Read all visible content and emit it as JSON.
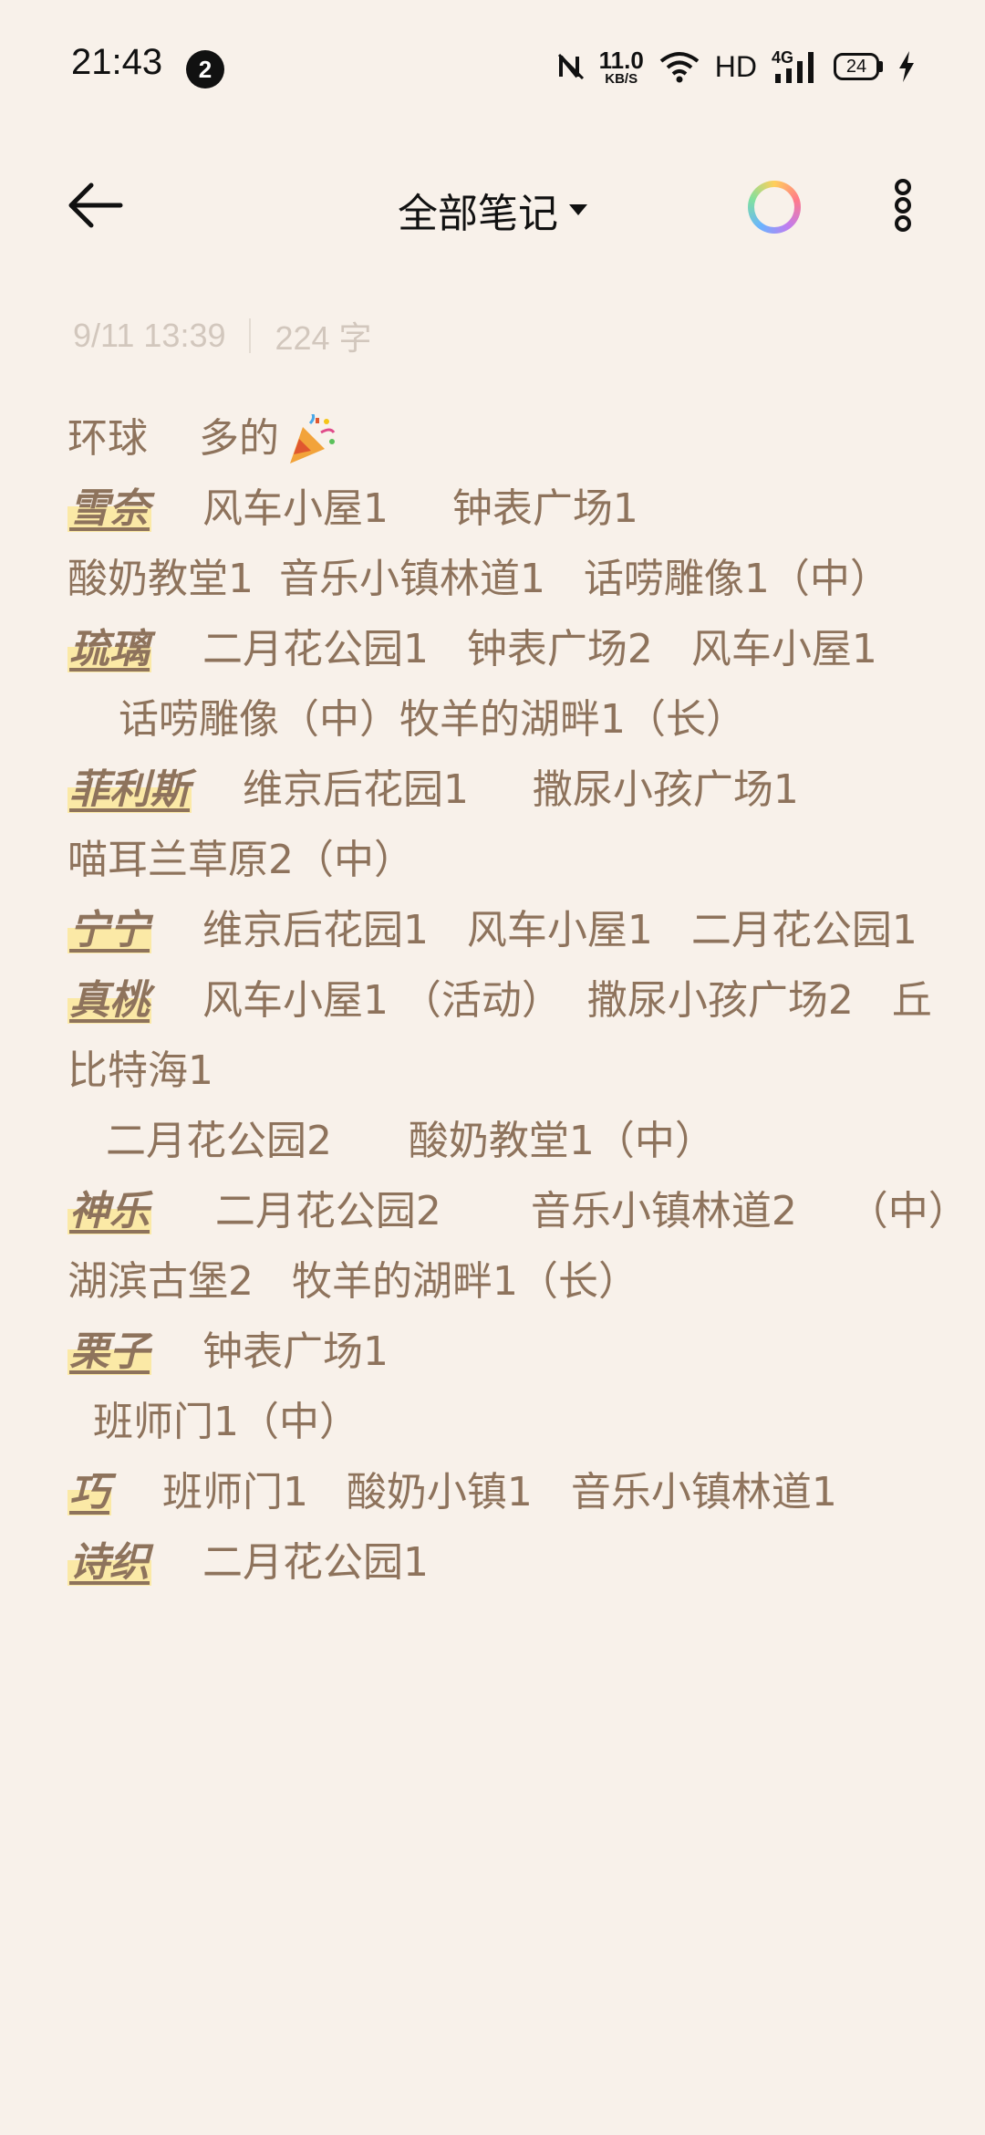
{
  "status_bar": {
    "time": "21:43",
    "notification_count": "2",
    "net_speed_value": "11.0",
    "net_speed_unit": "KB/S",
    "hd_label": "HD",
    "network_type": "4G",
    "battery_level": "24"
  },
  "app_bar": {
    "title": "全部笔记",
    "icons": [
      "back-arrow-icon",
      "dropdown-caret-icon",
      "theme-color-ring-icon",
      "more-vertical-icon"
    ]
  },
  "note": {
    "date": "9/11 13:39",
    "word_count": "224 字",
    "lines": [
      {
        "name": "",
        "text": "环球    多的"
      },
      {
        "name": "雪奈",
        "text": "    风车小屋1     钟表广场1"
      },
      {
        "name": "",
        "text": "酸奶教堂1  音乐小镇林道1   话唠雕像1（中）"
      },
      {
        "name": "琉璃",
        "text": "    二月花公园1   钟表广场2   风车小屋1"
      },
      {
        "name": "",
        "text": "    话唠雕像（中）牧羊的湖畔1（长）"
      },
      {
        "name": "菲利斯",
        "text": "    维京后花园1     撒尿小孩广场1"
      },
      {
        "name": "",
        "text": "喵耳兰草原2（中）"
      },
      {
        "name": "宁宁",
        "text": "    维京后花园1   风车小屋1   二月花公园1"
      },
      {
        "name": "真桃",
        "text": "    风车小屋1 （活动）  撒尿小孩广场2   丘"
      },
      {
        "name": "",
        "text": "比特海1"
      },
      {
        "name": "",
        "text": "   二月花公园2      酸奶教堂1（中）"
      },
      {
        "name": "神乐",
        "text": "     二月花公园2       音乐小镇林道2    （中）"
      },
      {
        "name": "",
        "text": "湖滨古堡2   牧羊的湖畔1（长）"
      },
      {
        "name": "栗子",
        "text": "    钟表广场1"
      },
      {
        "name": "",
        "text": "  班师门1（中）"
      },
      {
        "name": "巧",
        "text": "    班师门1   酸奶小镇1   音乐小镇林道1"
      },
      {
        "name": "诗织",
        "text": "    二月花公园1"
      }
    ]
  },
  "colors": {
    "background": "#f8f1ea",
    "note_text": "#8e735c",
    "name_highlight": "#fbe9a6",
    "meta_text": "#d2c7bd"
  }
}
